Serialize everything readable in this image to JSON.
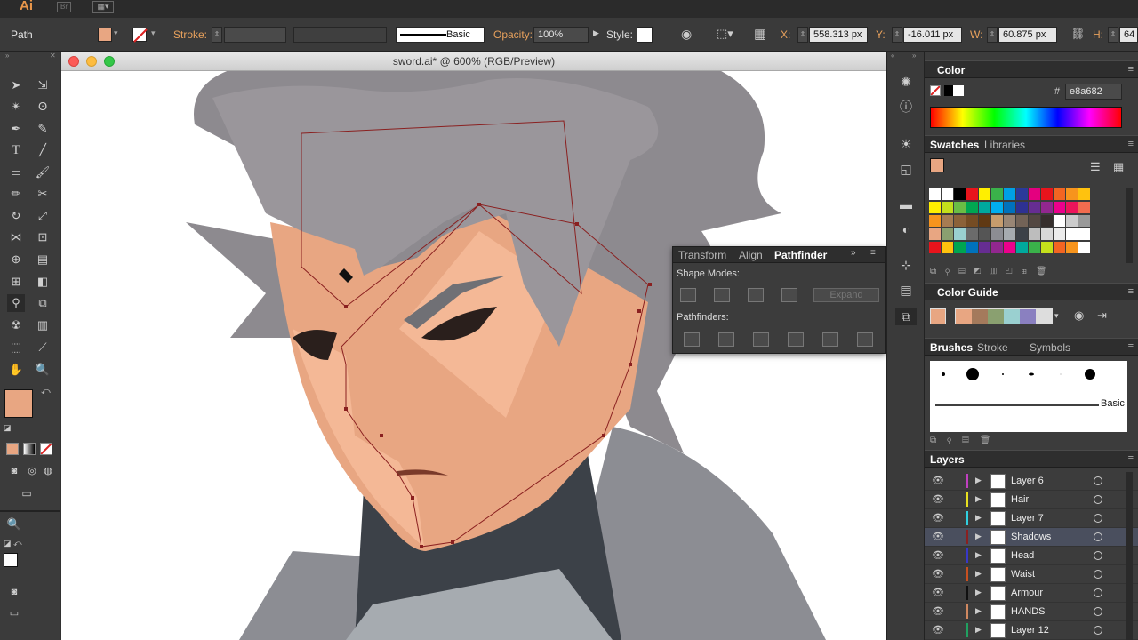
{
  "app": {
    "logo": "Ai",
    "bridge": "Br"
  },
  "control": {
    "selection": "Path",
    "stroke_label": "Stroke:",
    "brush_value": "Basic",
    "opacity_label": "Opacity:",
    "opacity_value": "100%",
    "style_label": "Style:",
    "x_label": "X:",
    "x_value": "558.313 px",
    "y_label": "Y:",
    "y_value": "-16.011 px",
    "w_label": "W:",
    "w_value": "60.875 px",
    "h_label": "H:",
    "h_value": "64"
  },
  "document": {
    "title": "sword.ai* @ 600% (RGB/Preview)"
  },
  "color_panel": {
    "tab": "Color",
    "hex_label": "#",
    "hex_value": "e8a682"
  },
  "swatches_panel": {
    "tabs": [
      "Swatches",
      "Libraries"
    ]
  },
  "color_guide_panel": {
    "tab": "Color Guide"
  },
  "brushes_panel": {
    "tabs": [
      "Brushes",
      "Stroke",
      "Symbols"
    ],
    "basic_label": "Basic"
  },
  "pathfinder": {
    "tabs": [
      "Transform",
      "Align",
      "Pathfinder"
    ],
    "shape_modes": "Shape Modes:",
    "expand": "Expand",
    "pathfinders": "Pathfinders:"
  },
  "layers": {
    "tab": "Layers",
    "items": [
      {
        "name": "Layer 6",
        "color": "#c040c0"
      },
      {
        "name": "Hair",
        "color": "#e8e020"
      },
      {
        "name": "Layer 7",
        "color": "#30d0e0"
      },
      {
        "name": "Shadows",
        "color": "#8a2020"
      },
      {
        "name": "Head",
        "color": "#3838c8"
      },
      {
        "name": "Waist",
        "color": "#c85020"
      },
      {
        "name": "Armour",
        "color": "#101010"
      },
      {
        "name": "HANDS",
        "color": "#d08860"
      },
      {
        "name": "Layer 12",
        "color": "#20a060"
      }
    ]
  },
  "colors": {
    "fill": "#e8a682",
    "accent": "#e8a15c"
  }
}
